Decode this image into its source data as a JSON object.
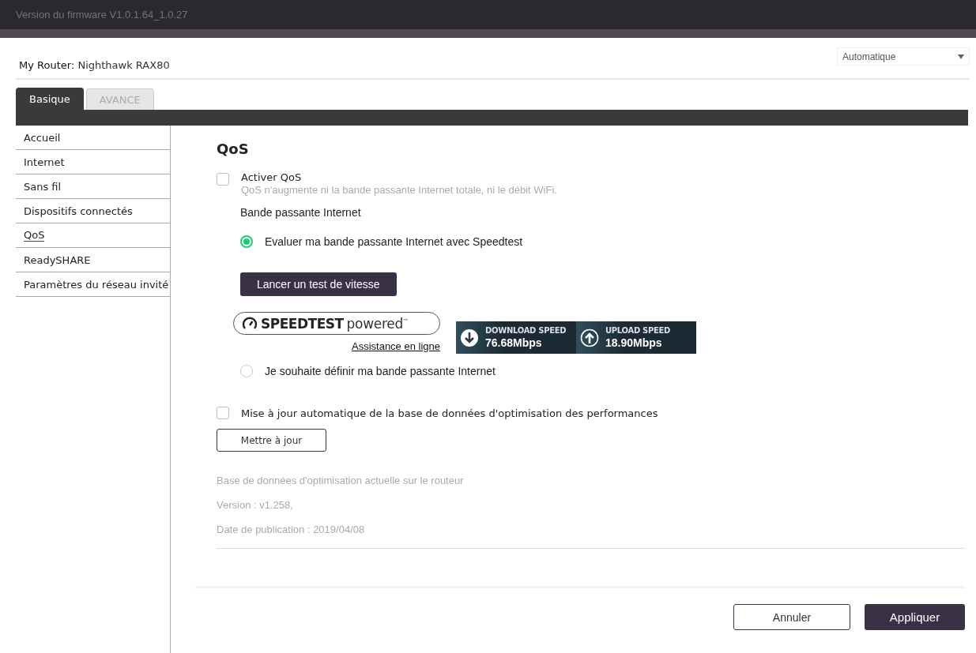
{
  "header": {
    "firmware": "Version du firmware V1.0.1.64_1.0.27",
    "router_label": "My Router:",
    "router_name": "Nighthawk RAX80",
    "language": "Automatique"
  },
  "tabs": [
    {
      "label": "Basique",
      "selected": true
    },
    {
      "label": "AVANCE",
      "selected": false
    }
  ],
  "sidebar": {
    "items": [
      {
        "label": "Accueil",
        "selected": false
      },
      {
        "label": "Internet",
        "selected": false
      },
      {
        "label": "Sans fil",
        "selected": false
      },
      {
        "label": "Dispositifs connectés",
        "selected": false
      },
      {
        "label": "QoS",
        "selected": true
      },
      {
        "label": "ReadySHARE",
        "selected": false
      },
      {
        "label": "Paramètres du réseau invité",
        "selected": false
      }
    ]
  },
  "qos": {
    "title": "QoS",
    "enable": {
      "label": "Activer QoS",
      "hint": "QoS n'augmente ni la bande passante Internet totale, ni le débit WiFi.",
      "checked": false
    },
    "bandwidth_label": "Bande passante Internet",
    "options": [
      {
        "label": "Evaluer ma bande passante Internet avec Speedtest",
        "selected": true
      },
      {
        "label": "Je souhaite définir ma bande passante Internet",
        "selected": false
      }
    ],
    "speedtest_button": "Lancer un test de vitesse",
    "speedtest_logo": {
      "brand": "SPEEDTEST",
      "suffix": "powered$^{™}$"
    },
    "help_link": "Assistance en ligne",
    "results": [
      {
        "kind": "download",
        "label": "DOWNLOAD SPEED",
        "value": "76.68Mbps"
      },
      {
        "kind": "upload",
        "label": "UPLOAD SPEED",
        "value": "18.90Mbps"
      }
    ],
    "auto_update": {
      "label": "Mise à jour automatique de la base de données d'optimisation des performances",
      "checked": false
    },
    "update_button": "Mettre à jour",
    "database": [
      "Base de données d'optimisation actuelle sur le routeur",
      "Version : v1.258,",
      "Date de publication : 2019/04/08"
    ]
  },
  "footer": {
    "buttons": [
      {
        "label": "Annuler",
        "kind": "secondary"
      },
      {
        "label": "Appliquer",
        "kind": "primary"
      }
    ]
  }
}
